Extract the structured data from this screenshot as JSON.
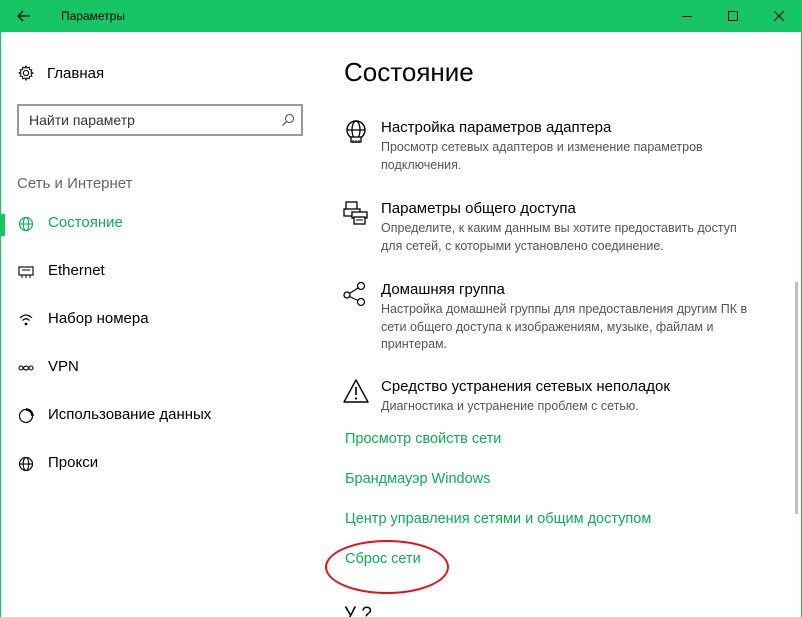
{
  "window": {
    "title": "Параметры",
    "accent_color": "#18c564"
  },
  "sidebar": {
    "home_label": "Главная",
    "search_placeholder": "Найти параметр",
    "section_title": "Сеть и Интернет",
    "items": [
      {
        "label": "Состояние",
        "icon": "globe-icon",
        "active": true
      },
      {
        "label": "Ethernet",
        "icon": "ethernet-icon",
        "active": false
      },
      {
        "label": "Набор номера",
        "icon": "dialup-icon",
        "active": false
      },
      {
        "label": "VPN",
        "icon": "vpn-icon",
        "active": false
      },
      {
        "label": "Использование данных",
        "icon": "data-usage-icon",
        "active": false
      },
      {
        "label": "Прокси",
        "icon": "globe-icon",
        "active": false
      }
    ]
  },
  "main": {
    "title": "Состояние",
    "entries": [
      {
        "title": "Настройка параметров адаптера",
        "description": "Просмотр сетевых адаптеров и изменение параметров подключения.",
        "icon": "adapter-globe-icon"
      },
      {
        "title": "Параметры общего доступа",
        "description": "Определите, к каким данным вы хотите предоставить доступ для сетей, с которыми установлено соединение.",
        "icon": "sharing-printer-icon"
      },
      {
        "title": "Домашняя группа",
        "description": "Настройка домашней группы для предоставления другим ПК в сети общего доступа к изображениям, музыке, файлам и принтерам.",
        "icon": "homegroup-icon"
      },
      {
        "title": "Средство устранения сетевых неполадок",
        "description": "Диагностика и устранение проблем с сетью.",
        "icon": "warning-icon"
      }
    ],
    "links": [
      "Просмотр свойств сети",
      "Брандмауэр Windows",
      "Центр управления сетями и общим доступом",
      "Сброс сети"
    ],
    "cutoff_heading": "У                    ?"
  },
  "annotation": {
    "color": "#e0121a"
  }
}
